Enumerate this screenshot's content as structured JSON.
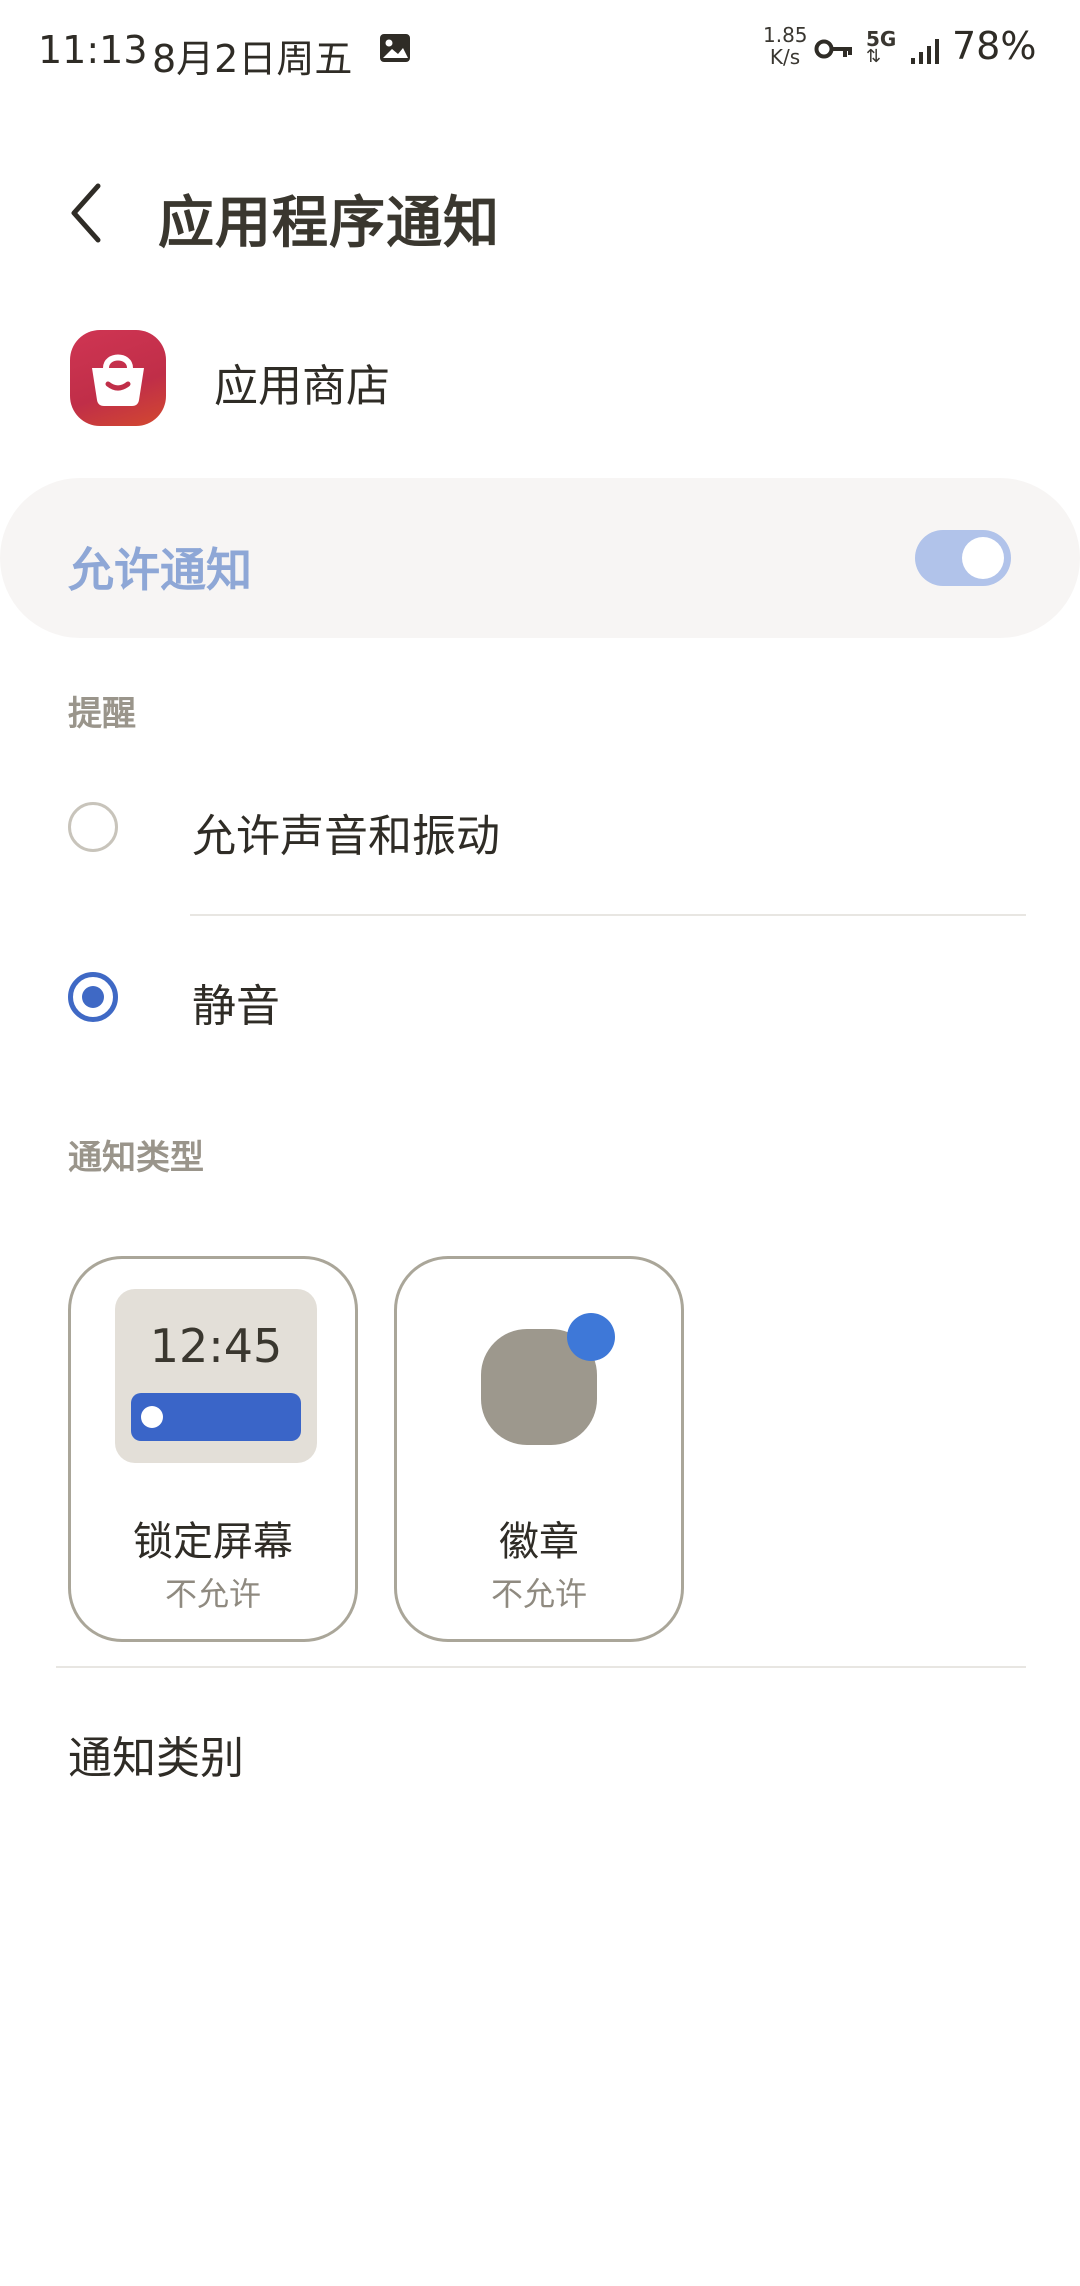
{
  "status_bar": {
    "time": "11:13",
    "date": "8月2日周五",
    "net_rate": "1.85",
    "net_rate_unit": "K/s",
    "network": "5G",
    "battery": "78%"
  },
  "header": {
    "title": "应用程序通知"
  },
  "app": {
    "name": "应用商店"
  },
  "allow_notifications": {
    "label": "允许通知",
    "enabled": true
  },
  "alerts": {
    "section_label": "提醒",
    "options": [
      {
        "label": "允许声音和振动",
        "selected": false
      },
      {
        "label": "静音",
        "selected": true
      }
    ]
  },
  "notification_types": {
    "section_label": "通知类型",
    "lock_preview_time": "12:45",
    "cards": [
      {
        "title": "锁定屏幕",
        "status": "不允许"
      },
      {
        "title": "徽章",
        "status": "不允许"
      }
    ]
  },
  "categories": {
    "label": "通知类别"
  },
  "colors": {
    "accent": "#3f69c5",
    "toggle_on": "#b1c3ea",
    "allow_label": "#8ea7d6"
  }
}
